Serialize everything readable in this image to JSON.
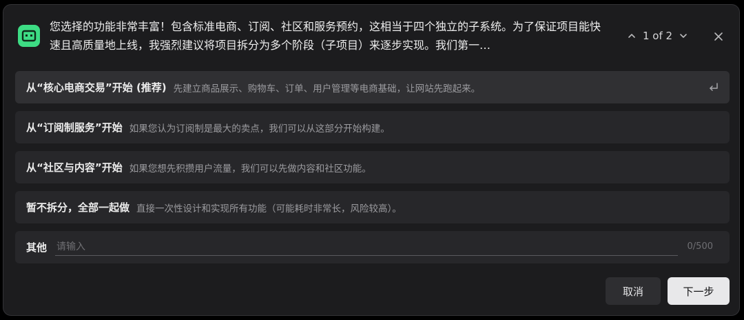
{
  "question": {
    "text": "您选择的功能非常丰富！包含标准电商、订阅、社区和服务预约，这相当于四个独立的子系统。为了保证项目能快速且高质量地上线，我强烈建议将项目拆分为多个阶段（子项目）来逐步实现。我们第一…"
  },
  "pager": {
    "label": "1 of 2"
  },
  "options": [
    {
      "title": "从“核心电商交易”开始 (推荐)",
      "description": "先建立商品展示、购物车、订单、用户管理等电商基础，让网站先跑起来。"
    },
    {
      "title": "从“订阅制服务”开始",
      "description": "如果您认为订阅制是最大的卖点，我们可以从这部分开始构建。"
    },
    {
      "title": "从“社区与内容”开始",
      "description": "如果您想先积攒用户流量，我们可以先做内容和社区功能。"
    },
    {
      "title": "暂不拆分，全部一起做",
      "description": "直接一次性设计和实现所有功能（可能耗时非常长，风险较高）。"
    }
  ],
  "other": {
    "label": "其他",
    "placeholder": "请输入",
    "value": "",
    "counter": "0/500"
  },
  "footer": {
    "cancel_label": "取消",
    "next_label": "下一步"
  },
  "colors": {
    "accent": "#3ddc84",
    "panel_bg": "#1c1c1e",
    "option_bg": "#27272a"
  }
}
